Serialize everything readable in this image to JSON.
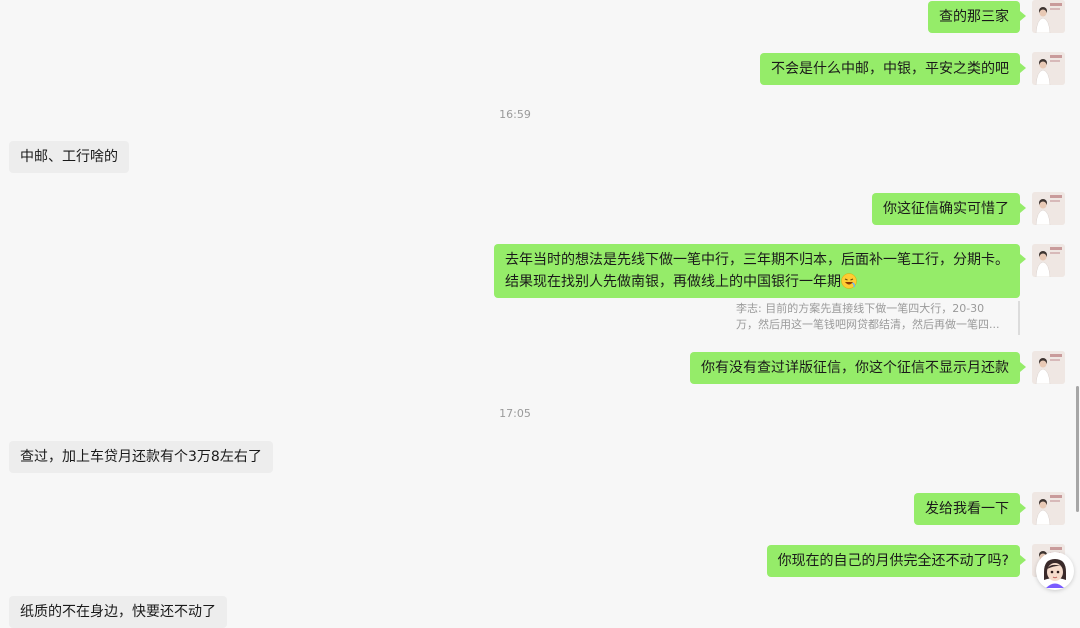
{
  "conversation": {
    "messages": [
      {
        "text": "查的那三家"
      },
      {
        "text": "不会是什么中邮，中银，平安之类的吧"
      },
      {
        "text": "中邮、工行啥的"
      },
      {
        "text": "你这征信确实可惜了"
      },
      {
        "line1": "去年当时的想法是先线下做一笔中行，三年期不归本，后面补一笔工行，分期卡。",
        "line2": "结果现在找别人先做南银，再做线上的中国银行一年期"
      },
      {
        "text": "你有没有查过详版征信，你这个征信不显示月还款"
      },
      {
        "text": "查过，加上车贷月还款有个3万8左右了"
      },
      {
        "text": "发给我看一下"
      },
      {
        "text": "你现在的自己的月供完全还不动了吗?"
      },
      {
        "text": "纸质的不在身边，快要还不动了"
      }
    ],
    "timestamps": [
      "16:59",
      "17:05"
    ],
    "quote": {
      "line1": "李志: 目前的方案先直接线下做一笔四大行，20-30",
      "line2": "万，然后用这一笔钱吧网贷都结清，然后再做一笔四..."
    },
    "emoji": "laughing-face-emoji"
  },
  "icons": {
    "avatar": "self-avatar-icon",
    "assistant": "assistant-avatar-icon"
  },
  "colors": {
    "outgoing_bubble": "#95ec69",
    "incoming_bubble": "#ededed",
    "background": "#f7f7f7"
  }
}
